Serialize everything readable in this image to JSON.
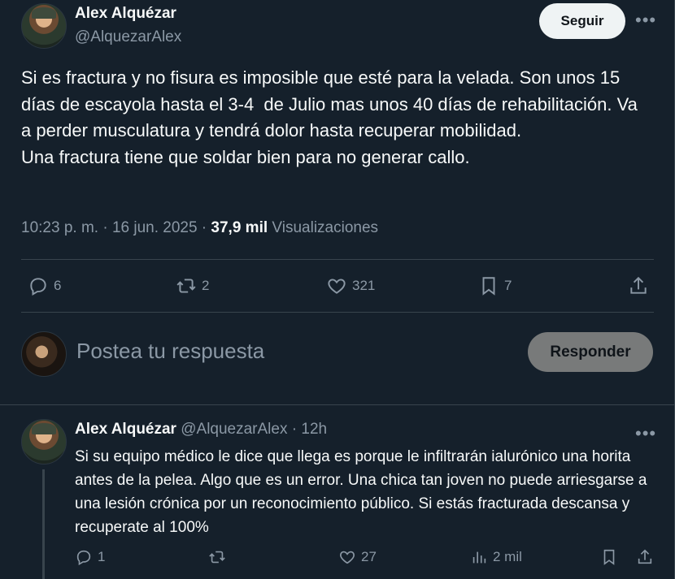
{
  "main_tweet": {
    "author_name": "Alex Alquézar",
    "handle": "@AlquezarAlex",
    "follow_label": "Seguir",
    "text": "Si es fractura y no fisura es imposible que esté para la velada. Son unos 15 días de escayola hasta el 3-4  de Julio mas unos 40 días de rehabilitación. Va a perder musculatura y tendrá dolor hasta recuperar mobilidad.\nUna fractura tiene que soldar bien para no generar callo.",
    "timestamp": "10:23 p. m. · 16 jun. 2025 ·",
    "views_count": "37,9 mil",
    "views_label": "Visualizaciones",
    "stats": {
      "replies": "6",
      "reposts": "2",
      "likes": "321",
      "bookmarks": "7"
    }
  },
  "reply_box": {
    "placeholder": "Postea tu respuesta",
    "button_label": "Responder"
  },
  "reply_tweet": {
    "author_name": "Alex Alquézar",
    "handle": "@AlquezarAlex",
    "time": "· 12h",
    "text": "Si su equipo médico le dice que llega es porque le infiltrarán ialurónico una horita antes de la pelea. Algo que es un error. Una chica tan joven no puede arriesgarse a una lesión crónica por un reconocimiento público. Si estás fracturada descansa y recuperate al 100%",
    "stats": {
      "replies": "1",
      "likes": "27",
      "views": "2 mil"
    }
  },
  "icons": [
    "more-icon",
    "reply-icon",
    "repost-icon",
    "like-icon",
    "bookmark-icon",
    "share-icon",
    "analytics-icon"
  ],
  "colors": {
    "background": "#15202b",
    "text": "#f7f9f9",
    "secondary": "#8b98a5",
    "border": "#38444d"
  }
}
